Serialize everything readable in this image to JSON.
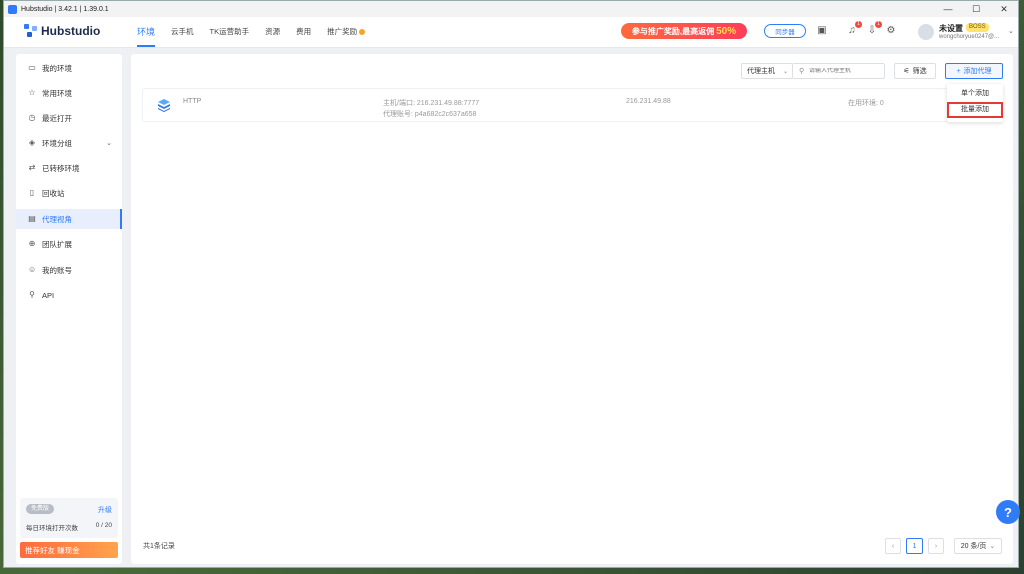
{
  "window": {
    "title": "Hubstudio | 3.42.1 | 1.39.0.1",
    "controls": [
      "—",
      "☐",
      "✕"
    ]
  },
  "header": {
    "logo": "Hubstudio",
    "nav": [
      "环境",
      "云手机",
      "TK运营助手",
      "资源",
      "费用",
      "推广奖励"
    ],
    "promo_text": "参与推广奖励,最高返佣",
    "promo_pct": "50%",
    "sync_label": "同步器",
    "notif_badge_1": "1",
    "notif_badge_2": "1",
    "user_name": "未设置",
    "user_badge": "BOSS",
    "user_email": "wongchoryue0247@..."
  },
  "sidebar": {
    "items": [
      {
        "label": "我的环境",
        "icon": "monitor-icon"
      },
      {
        "label": "常用环境",
        "icon": "star-icon"
      },
      {
        "label": "最近打开",
        "icon": "clock-icon"
      },
      {
        "label": "环境分组",
        "icon": "layers-icon"
      },
      {
        "label": "已转移环境",
        "icon": "transfer-icon"
      },
      {
        "label": "回收站",
        "icon": "trash-icon"
      },
      {
        "label": "代理视角",
        "icon": "proxy-icon"
      },
      {
        "label": "团队扩展",
        "icon": "team-icon"
      },
      {
        "label": "我的账号",
        "icon": "user-icon"
      },
      {
        "label": "API",
        "icon": "api-icon"
      }
    ],
    "plan_tag": "免费版",
    "upgrade": "升级",
    "daily_label": "每日环境打开次数",
    "daily_count": "0 / 20",
    "invite": "推荐好友 赚现金"
  },
  "main": {
    "filter_select": "代理主机",
    "search_placeholder": "请输入代理主机",
    "filter_btn": "筛选",
    "add_btn": "添加代理",
    "row": {
      "type": "HTTP",
      "host": "主机/端口: 216.231.49.88:7777",
      "account": "代理账号: p4a682c2c637a658",
      "ip": "216.231.49.88",
      "used": "在用环境: 0"
    },
    "dropdown": [
      "单个添加",
      "批量添加"
    ],
    "records": "共1条记录",
    "page": "1",
    "page_size": "20 条/页"
  }
}
